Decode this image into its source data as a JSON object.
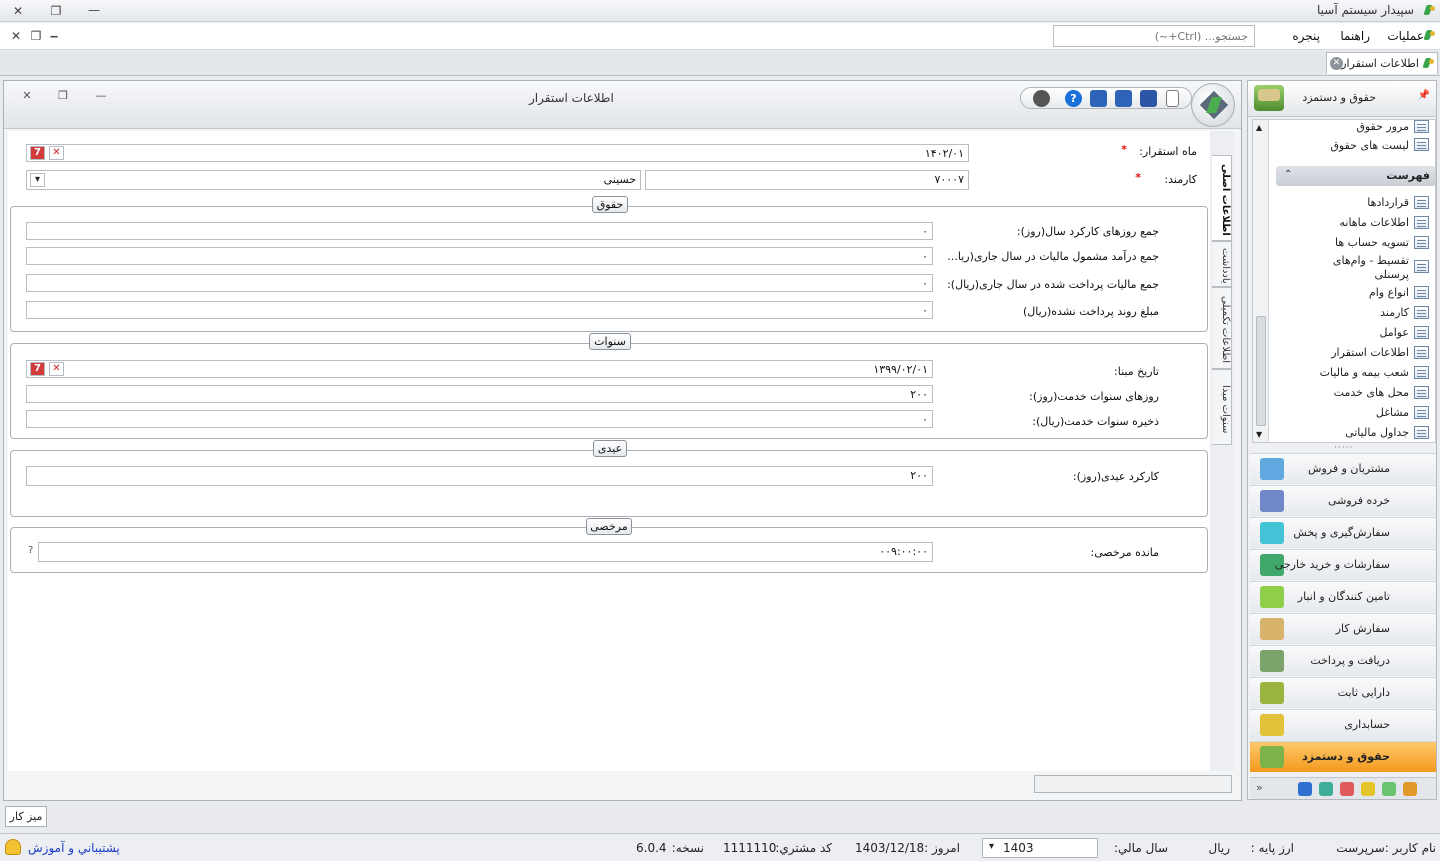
{
  "app": {
    "title": "سپیدار سیستم آسیا",
    "window_buttons": {
      "close": "✕",
      "restore": "❐",
      "minimize": "—"
    }
  },
  "menu": {
    "items": [
      "عملیات",
      "راهنما",
      "پنجره"
    ],
    "search_placeholder": "جستجو... (Ctrl+~)",
    "mdi_buttons": {
      "close": "✕",
      "restore": "❐",
      "minimize": "‒"
    }
  },
  "doc_tab": {
    "label": "اطلاعات استقرار",
    "close": "✕"
  },
  "document": {
    "title": "اطلاعات استقرار",
    "window_buttons": {
      "close": "✕",
      "restore": "❐",
      "minimize": "—"
    },
    "toolbar_icons": [
      "new-document-icon",
      "save-icon",
      "save-and-new-icon",
      "save-and-close-icon",
      "help-icon",
      "wrench-icon"
    ]
  },
  "form": {
    "month_label": "ماه استقرار:",
    "month_value": "۱۴۰۲/۰۱",
    "employee_label": "کارمند:",
    "employee_code": "۷۰۰۰۷",
    "employee_name": "حسینی",
    "required_mark": "*",
    "cal_glyph": "7",
    "clear_glyph": "✕",
    "dropdown_glyph": "▾",
    "help_glyph": "?"
  },
  "groups": {
    "salary": {
      "title": "حقوق",
      "rows": [
        {
          "label": "جمع روزهای کارکرد سال(روز):",
          "value": "۰"
        },
        {
          "label": "جمع درآمد مشمول مالیات در سال جاری(ریا...",
          "value": "۰"
        },
        {
          "label": "جمع مالیات پرداخت شده در سال جاری(ریال):",
          "value": "۰"
        },
        {
          "label": "مبلغ روند پرداخت نشده(ریال)",
          "value": "۰"
        }
      ]
    },
    "seniority": {
      "title": "سنوات",
      "rows": [
        {
          "label": "تاریخ مبنا:",
          "value": "۱۳۹۹/۰۲/۰۱"
        },
        {
          "label": "روزهای سنوات خدمت(روز):",
          "value": "۲۰۰"
        },
        {
          "label": "ذخیره سنوات خدمت(ریال):",
          "value": "۰"
        }
      ]
    },
    "bonus": {
      "title": "عیدی",
      "rows": [
        {
          "label": "کارکرد عیدی(روز):",
          "value": "۲۰۰"
        }
      ]
    },
    "leave": {
      "title": "مرخصی",
      "rows": [
        {
          "label": "مانده مرخصی:",
          "value": "۰۰۹:۰۰:۰۰"
        }
      ]
    }
  },
  "side_tabs": [
    "اطلاعات اصلی",
    "یادداشت",
    "اطلاعات تکمیلی",
    "سنوات مبدا"
  ],
  "navigator": {
    "header": "حقوق و دستمزد",
    "pin": "📌",
    "top_items": [
      "مرور حقوق",
      "لیست های حقوق"
    ],
    "section": "فهرست",
    "section_toggle": "⌃",
    "scroll_up": "▲",
    "scroll_down": "▼",
    "items": [
      "قراردادها",
      "اطلاعات ماهانه",
      "تسویه حساب ها",
      "تقسیط - وام‌های پرسنلی",
      "انواع وام",
      "کارمند",
      "عوامل",
      "اطلاعات استقرار",
      "شعب بیمه و مالیات",
      "محل های خدمت",
      "مشاغل",
      "جداول مالیاتی"
    ],
    "splitter": "·····",
    "modules": [
      {
        "label": "مشتریان و فروش",
        "color": "#5fa8e0"
      },
      {
        "label": "خرده فروشی",
        "color": "#6f88c9"
      },
      {
        "label": "سفارش‌گیری و پخش",
        "color": "#44c3d6"
      },
      {
        "label": "سفارشات و خرید خارجی",
        "color": "#3fa86a"
      },
      {
        "label": "تامین کنندگان و انبار",
        "color": "#8fcf4a"
      },
      {
        "label": "سفارش کار",
        "color": "#d7b46a"
      },
      {
        "label": "دریافت و پرداخت",
        "color": "#7ba36a"
      },
      {
        "label": "دارایی ثابت",
        "color": "#9ab53f"
      },
      {
        "label": "حسابداری",
        "color": "#e2c23a"
      },
      {
        "label": "حقوق و دستمزد",
        "color": "#7cb34a"
      }
    ],
    "footer_icons": [
      {
        "name": "globe-icon",
        "color": "#2f6fd0"
      },
      {
        "name": "box-icon",
        "color": "#3fae98"
      },
      {
        "name": "chart-icon",
        "color": "#e05a5a"
      },
      {
        "name": "leaf-icon",
        "color": "#e3c52a"
      },
      {
        "name": "star-icon",
        "color": "#6ac36f"
      },
      {
        "name": "tools-icon",
        "color": "#e39a2a"
      }
    ],
    "footer_more": "»"
  },
  "desktop_tab": "میز کار",
  "status": {
    "user": "نام کاربر :سرپرست",
    "base_currency_label": "ارز پایه :",
    "base_currency": "ریال",
    "fiscal_year_label": "سال مالي:",
    "fiscal_year": "1403",
    "fiscal_dropdown": "▾",
    "today_label": "امروز :",
    "today": "1403/12/18",
    "customer_code_label": "کد مشتري:",
    "customer_code": "1111110",
    "version_label": "نسخه:",
    "version": "6.0.4",
    "support": "پشتيباني و آموزش"
  },
  "colors": {
    "accent": "#f39a1d",
    "required": "#dd1111",
    "link": "#1a3dc7"
  }
}
